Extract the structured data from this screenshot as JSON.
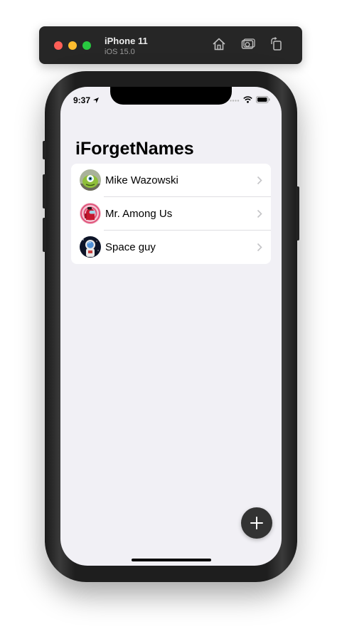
{
  "simulator": {
    "device_name": "iPhone 11",
    "os_version": "iOS 15.0",
    "buttons": [
      "home-icon",
      "screenshot-icon",
      "rotate-icon"
    ]
  },
  "status_bar": {
    "time": "9:37"
  },
  "screen": {
    "title": "iForgetNames",
    "people": [
      {
        "name": "Mike Wazowski",
        "avatar": "green-creature-avatar"
      },
      {
        "name": "Mr. Among Us",
        "avatar": "crewmate-avatar"
      },
      {
        "name": "Space guy",
        "avatar": "astronaut-avatar"
      }
    ],
    "add_button_icon": "plus-icon"
  },
  "colors": {
    "background": "#f1f0f5",
    "card": "#ffffff",
    "fab": "#333333",
    "chevron": "#c4c4c7"
  }
}
